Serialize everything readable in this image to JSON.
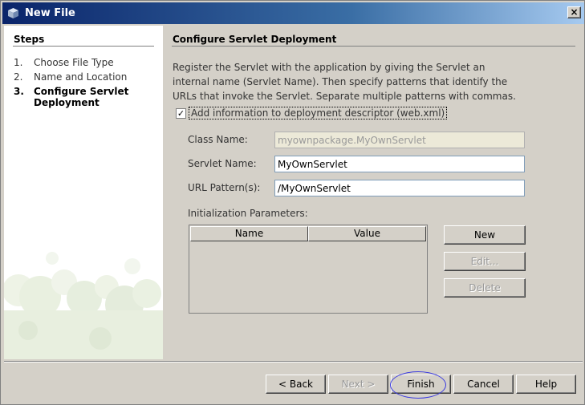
{
  "window": {
    "title": "New File",
    "close_glyph": "×"
  },
  "steps": {
    "heading": "Steps",
    "items": [
      {
        "num": "1.",
        "label": "Choose File Type"
      },
      {
        "num": "2.",
        "label": "Name and Location"
      },
      {
        "num": "3.",
        "label": "Configure Servlet",
        "label2": "Deployment",
        "current": true
      }
    ]
  },
  "content": {
    "heading": "Configure Servlet Deployment",
    "description": "Register the Servlet with the application by giving the Servlet an internal name (Servlet Name). Then specify patterns that identify the URLs that invoke the Servlet. Separate multiple patterns with commas.",
    "checkbox_checked": true,
    "checkbox_glyph": "✓",
    "checkbox_label": "Add information to deployment descriptor (web.xml)",
    "class_name_label": "Class Name:",
    "class_name_value": "myownpackage.MyOwnServlet",
    "servlet_name_label": "Servlet Name:",
    "servlet_name_value": "MyOwnServlet",
    "url_pattern_label": "URL Pattern(s):",
    "url_pattern_value": "/MyOwnServlet",
    "params_label": "Initialization Parameters:",
    "params_columns": [
      "Name",
      "Value"
    ],
    "new_button": "New",
    "edit_button": "Edit...",
    "delete_button": "Delete"
  },
  "buttons": {
    "back": "< Back",
    "next": "Next >",
    "finish": "Finish",
    "cancel": "Cancel",
    "help": "Help"
  },
  "colors": {
    "title_gradient_start": "#0a246a",
    "annotation_ellipse": "#3a3ae0"
  }
}
